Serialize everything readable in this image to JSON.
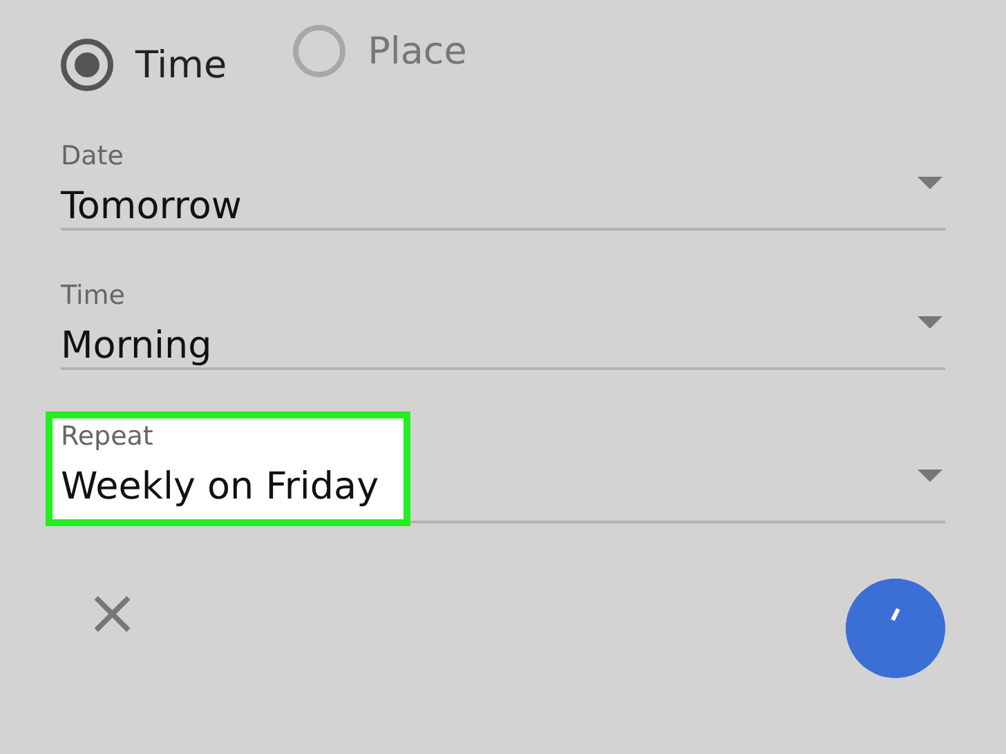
{
  "trigger_options": [
    {
      "label": "Time",
      "selected": true
    },
    {
      "label": "Place",
      "selected": false
    }
  ],
  "fields": [
    {
      "label": "Date",
      "value": "Tomorrow",
      "highlighted": false
    },
    {
      "label": "Time",
      "value": "Morning",
      "highlighted": false
    },
    {
      "label": "Repeat",
      "value": "Weekly on Friday",
      "highlighted": true
    }
  ],
  "close_button": {
    "label": "×"
  }
}
